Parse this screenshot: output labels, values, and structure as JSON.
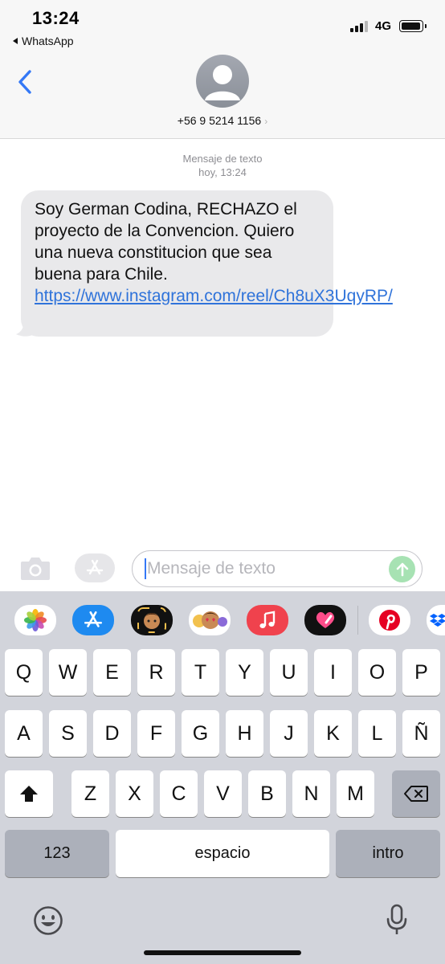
{
  "status": {
    "time": "13:24",
    "back_app": "WhatsApp",
    "network": "4G"
  },
  "header": {
    "contact": "+56 9 5214 1156"
  },
  "conversation": {
    "label": "Mensaje de texto",
    "timestamp": "hoy, 13:24",
    "message": {
      "text": "Soy German Codina, RECHAZO el proyecto de la Convencion. Quiero una nueva constitucion que sea buena para Chile. ",
      "link": "https://www.instagram.com/reel/Ch8uX3UqyRP/"
    }
  },
  "compose": {
    "placeholder": "Mensaje de texto",
    "value": ""
  },
  "app_strip": [
    "photos-icon",
    "app-store-icon",
    "memoji-icon",
    "memoji-stickers-icon",
    "music-icon",
    "digital-touch-icon",
    "pinterest-icon",
    "dropbox-icon"
  ],
  "keyboard": {
    "rows": [
      [
        "Q",
        "W",
        "E",
        "R",
        "T",
        "Y",
        "U",
        "I",
        "O",
        "P"
      ],
      [
        "A",
        "S",
        "D",
        "F",
        "G",
        "H",
        "J",
        "K",
        "L",
        "Ñ"
      ],
      [
        "Z",
        "X",
        "C",
        "V",
        "B",
        "N",
        "M"
      ]
    ],
    "numbers_label": "123",
    "space_label": "espacio",
    "return_label": "intro"
  },
  "colors": {
    "link": "#2f73da",
    "bubble": "#e9e9eb",
    "accent": "#3478f6",
    "send": "#a7e2b3",
    "keyboard_bg": "#d2d4db"
  }
}
